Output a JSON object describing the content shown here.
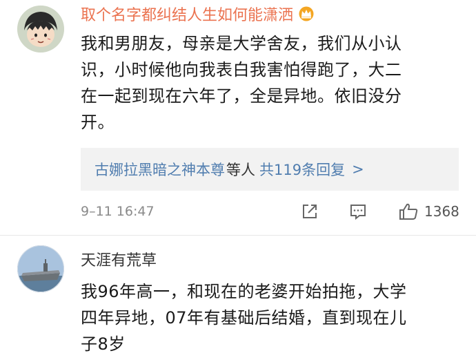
{
  "comments": [
    {
      "username": "取个名字都纠结人生如何能潇洒",
      "badge_icon": "crown-icon",
      "text_lines": [
        "我和男朋友，母亲是大学舍友，我们从小认",
        "识，小时候他向我表白我害怕得跑了，大二",
        "在一起到现在六年了，全是异地。依旧没分",
        "开。"
      ],
      "replies": {
        "replier": "古娜拉黑暗之神本尊",
        "mid": "等人",
        "count": "共119条回复",
        "chevron": ">"
      },
      "timestamp": "9–11 16:47",
      "likes": "1368"
    },
    {
      "username": "天涯有荒草",
      "text_lines": [
        "我96年高一，和现在的老婆开始拍拖，大学",
        "四年异地，07年有基础后结婚，直到现在儿",
        "子8岁"
      ]
    }
  ],
  "colors": {
    "username_highlight": "#eb7350",
    "link": "#507daf",
    "meta": "#8a8a8a"
  }
}
